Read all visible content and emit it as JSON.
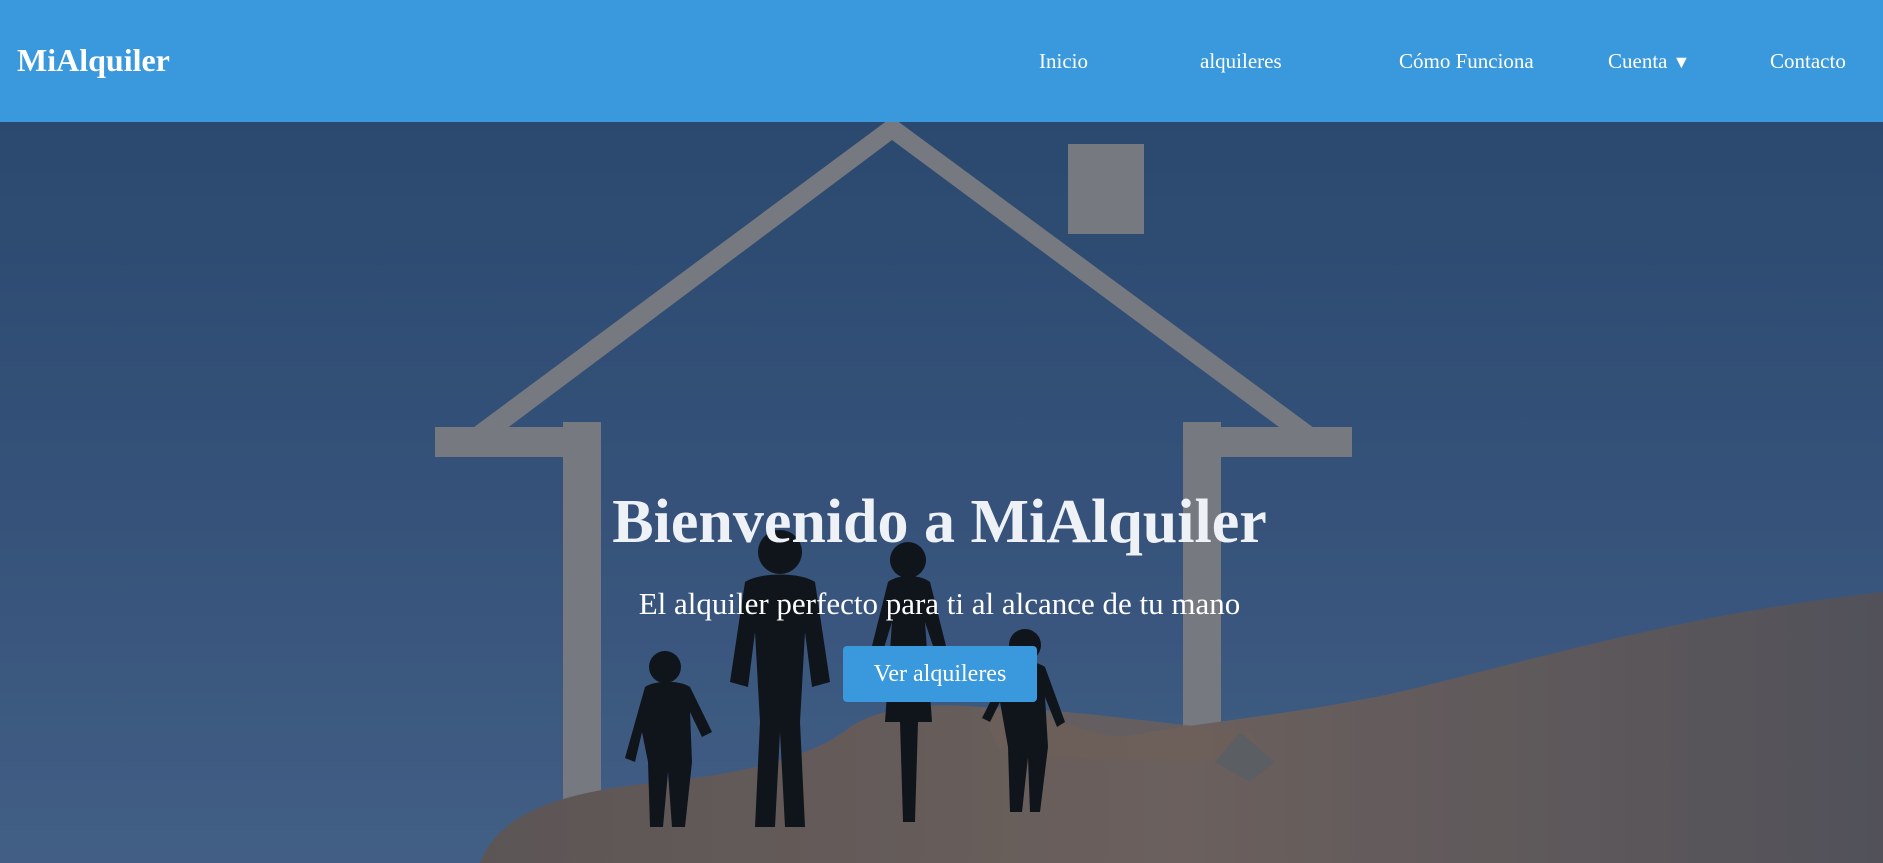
{
  "brand": {
    "name": "MiAlquiler"
  },
  "nav": {
    "items": [
      {
        "label": "Inicio"
      },
      {
        "label": "alquileres"
      },
      {
        "label": "Cómo Funciona"
      },
      {
        "label": "Cuenta",
        "caret": "▼"
      },
      {
        "label": "Contacto"
      }
    ]
  },
  "hero": {
    "title": "Bienvenido a MiAlquiler",
    "subtitle": "El alquiler perfecto para ti al alcance de tu mano",
    "cta_label": "Ver alquileres",
    "background_image": "house-family-in-hand-photo"
  },
  "colors": {
    "navbar": "#3a98dc",
    "button": "#3a98dc",
    "hero_overlay": "#3e5c85",
    "text": "#ffffff"
  }
}
